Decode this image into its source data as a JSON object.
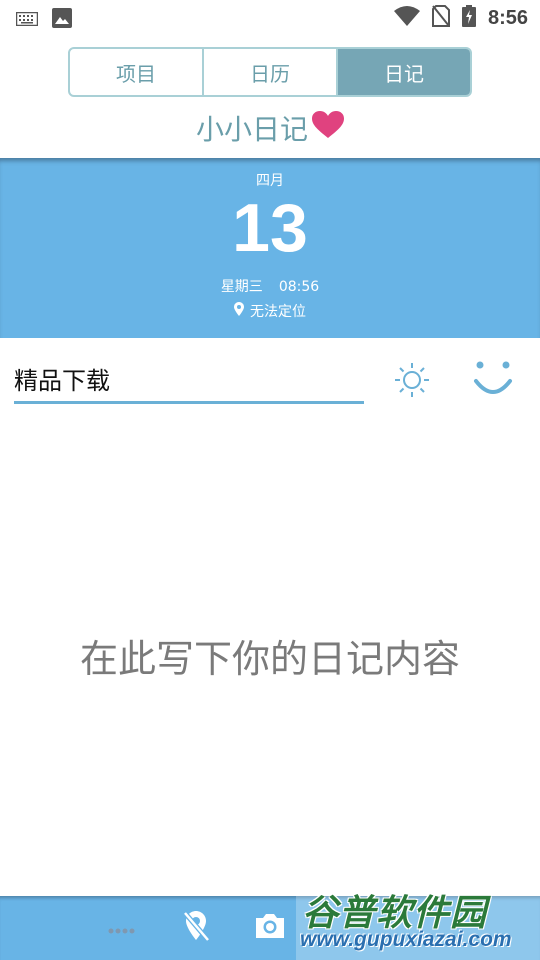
{
  "status_bar": {
    "time": "8:56",
    "icons": [
      "keyboard-icon",
      "image-icon",
      "wifi-icon",
      "no-sim-icon",
      "battery-charging-icon"
    ]
  },
  "tabs": [
    {
      "label": "项目",
      "active": false
    },
    {
      "label": "日历",
      "active": false
    },
    {
      "label": "日记",
      "active": true
    }
  ],
  "app_title": "小小日记",
  "date_panel": {
    "month": "四月",
    "day": "13",
    "weekday": "星期三",
    "time": "08:56",
    "location": "无法定位"
  },
  "entry": {
    "title_value": "精品下载",
    "body_placeholder": "在此写下你的日记内容"
  },
  "toolbar": {
    "icons": [
      "more-icon",
      "location-off-icon",
      "camera-icon"
    ]
  },
  "watermark": {
    "brand": "谷普软件园",
    "url": "www.gupuxiazai.com"
  },
  "colors": {
    "accent": "#68b4e6",
    "tab_active": "#76a6b5",
    "tab_text": "#6a9eaa",
    "heart": "#e0427f"
  }
}
